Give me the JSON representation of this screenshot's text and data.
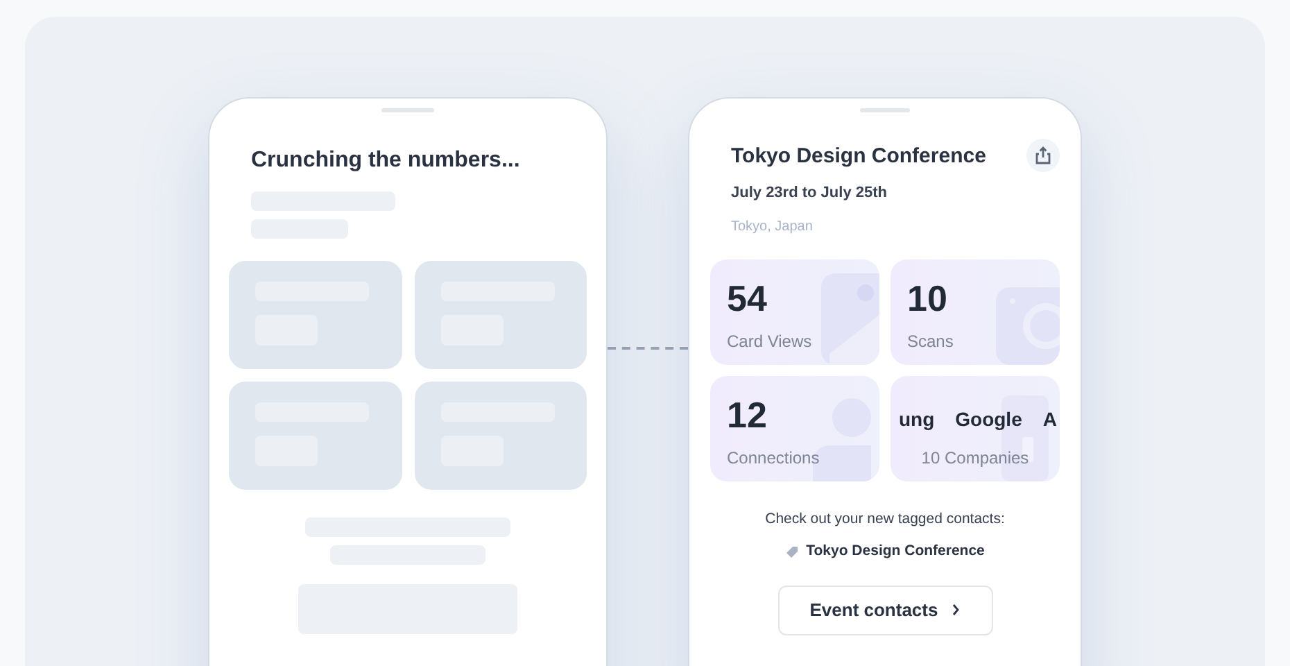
{
  "loading_screen": {
    "title": "Crunching the numbers..."
  },
  "event_screen": {
    "title": "Tokyo Design Conference",
    "dates": "July 23rd to July 25th",
    "location": "Tokyo, Japan",
    "stats": [
      {
        "kind": "number",
        "value": "54",
        "label": "Card Views"
      },
      {
        "kind": "number",
        "value": "10",
        "label": "Scans"
      },
      {
        "kind": "number",
        "value": "12",
        "label": "Connections"
      },
      {
        "kind": "logos",
        "logos": [
          "ung",
          "Google",
          "A"
        ],
        "label": "10 Companies"
      }
    ],
    "tagged_note": "Check out your new tagged contacts:",
    "tag": "Tokyo Design Conference",
    "button": "Event contacts"
  }
}
